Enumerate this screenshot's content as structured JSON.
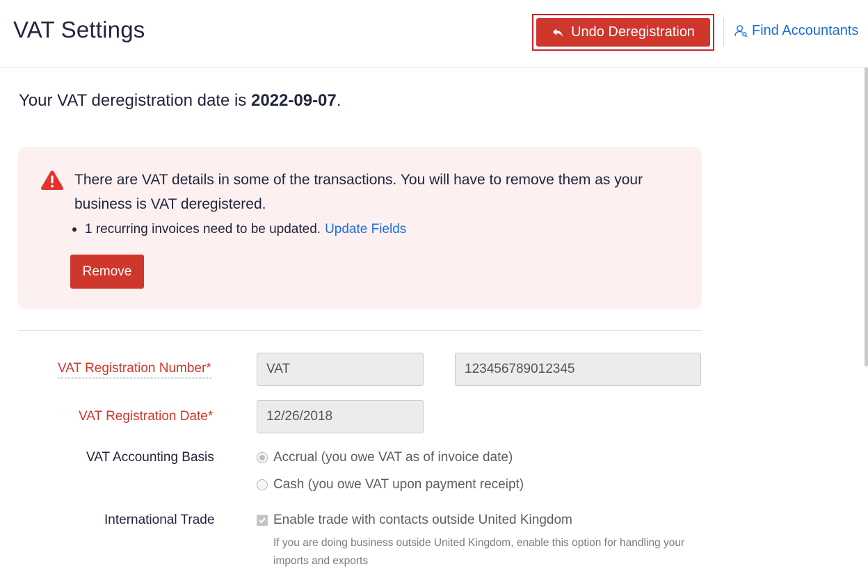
{
  "header": {
    "title": "VAT Settings",
    "undo_label": "Undo Deregistration",
    "find_accountants_label": "Find Accountants"
  },
  "deregistration": {
    "prefix": "Your VAT deregistration date is ",
    "date": "2022-09-07",
    "suffix": "."
  },
  "alert": {
    "message": "There are VAT details in some of the transactions. You will have to remove them as your business is VAT deregistered.",
    "bullet_text": "1 recurring invoices need to be updated.",
    "bullet_link": "Update Fields",
    "remove_label": "Remove"
  },
  "form": {
    "vat_reg_number_label": "VAT Registration Number*",
    "vat_reg_prefix_value": "VAT",
    "vat_reg_number_value": "123456789012345",
    "vat_reg_date_label": "VAT Registration Date*",
    "vat_reg_date_value": "12/26/2018",
    "accounting_basis_label": "VAT Accounting Basis",
    "accounting_basis_options": [
      {
        "label": "Accrual (you owe VAT as of invoice date)",
        "selected": true
      },
      {
        "label": "Cash (you owe VAT upon payment receipt)",
        "selected": false
      }
    ],
    "international_trade_label": "International Trade",
    "international_trade_checkbox_label": "Enable trade with contacts outside United Kingdom",
    "international_trade_checked": true,
    "international_trade_help": "If you are doing business outside United Kingdom, enable this option for handling your imports and exports"
  },
  "colors": {
    "primary_red": "#d0372c",
    "link_blue": "#1c6ed6",
    "alert_bg": "#fdf0f1"
  },
  "icons": {
    "undo": "undo-arrow-icon",
    "find_accountants": "user-search-icon",
    "alert": "warning-triangle-icon"
  }
}
